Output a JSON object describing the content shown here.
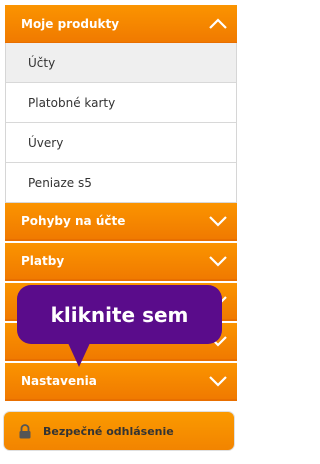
{
  "menu": {
    "products": {
      "label": "Moje produkty",
      "items": [
        {
          "label": "Účty",
          "active": true
        },
        {
          "label": "Platobné karty",
          "active": false
        },
        {
          "label": "Úvery",
          "active": false
        },
        {
          "label": "Peniaze s5",
          "active": false
        }
      ]
    },
    "movements": {
      "label": "Pohyby na účte"
    },
    "payments": {
      "label": "Platby"
    },
    "hidden_section": {
      "label": ""
    },
    "hidden_section2": {
      "label": ""
    },
    "settings": {
      "label": "Nastavenia"
    }
  },
  "logout": {
    "label": "Bezpečné odhlásenie",
    "icon": "lock-icon"
  },
  "tooltip": {
    "text": "kliknite sem"
  },
  "colors": {
    "accent": "#f58a00",
    "tooltip": "#5a0c8b"
  }
}
